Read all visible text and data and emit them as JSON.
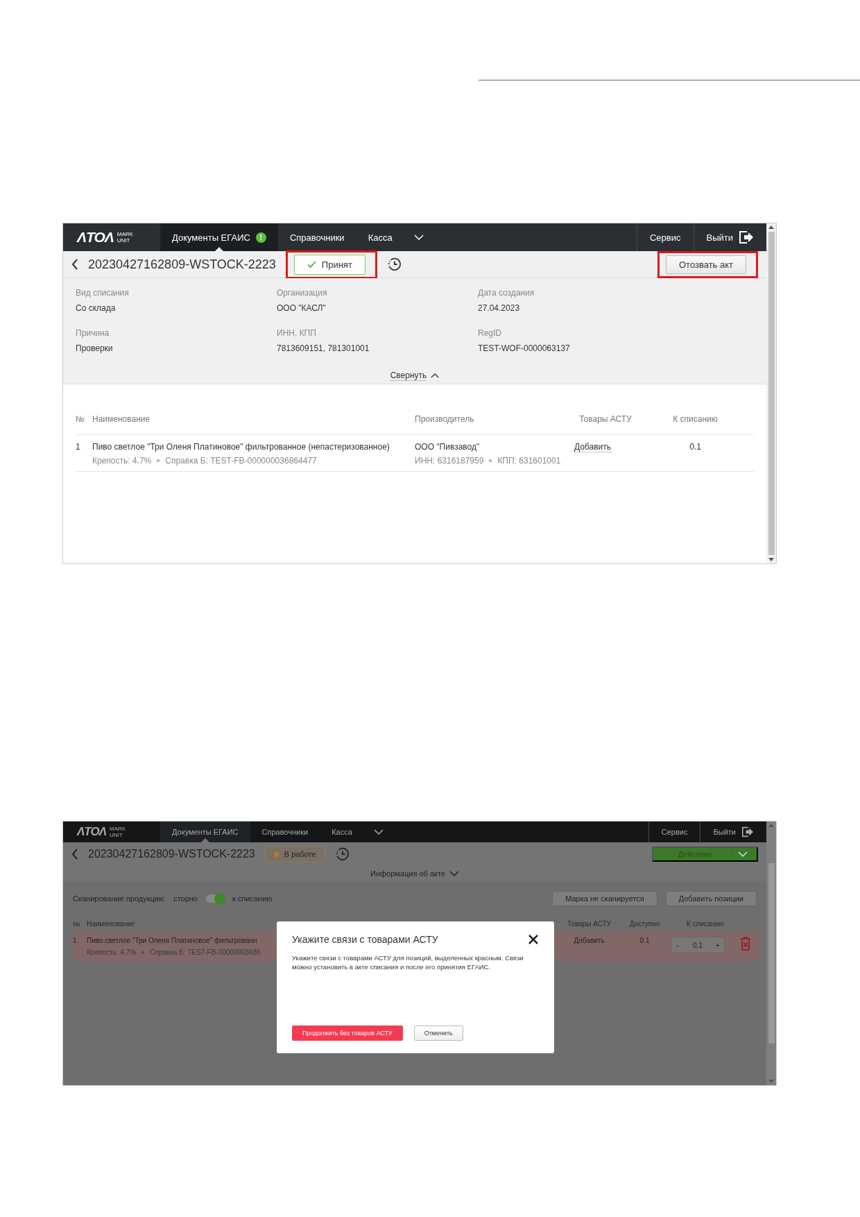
{
  "screen_accepted": {
    "nav": {
      "logo": "ΛTOΛ",
      "logo_tag_lines": [
        "MARK",
        "UNIT"
      ],
      "items": [
        {
          "label": "Документы ЕГАИС",
          "selected": true,
          "badge": "!"
        },
        {
          "label": "Справочники",
          "selected": false
        },
        {
          "label": "Касса",
          "selected": false
        }
      ],
      "right_items": [
        {
          "kind": "link",
          "label": "Сервис"
        },
        {
          "kind": "logout",
          "label": "Выйти"
        }
      ]
    },
    "document_number": "20230427162809-WSTOCK-2223",
    "status": {
      "kind": "accepted",
      "label": "Принят",
      "annotated": true
    },
    "action_button": {
      "label": "Отозвать акт",
      "annotated": true
    },
    "fields": [
      {
        "label": "Вид списания",
        "value": "Со склада"
      },
      {
        "label": "Организация",
        "value": "ООО \"КАСЛ\""
      },
      {
        "label": "Дата создания",
        "value": "27.04.2023"
      },
      {
        "label": "Причина",
        "value": "Проверки"
      },
      {
        "label": "ИНН, КПП",
        "value": "7813609151, 781301001"
      },
      {
        "label": "RegID",
        "value": "TEST-WOF-0000063137"
      }
    ],
    "collapse_link": "Свернуть",
    "table": {
      "columns": [
        "№",
        "Наименование",
        "Производитель",
        "Товары АСТУ",
        "К списанию"
      ],
      "rows": [
        {
          "number": "1",
          "name": "Пиво светлое \"Три Оленя Платиновое\" фильтрованное (непастеризованное)",
          "details": [
            "Крепость: 4.7%",
            "Справка Б: TEST-FB-000000036864477"
          ],
          "producer": "ООО \"Пивзавод\"",
          "producer_details": [
            "ИНН: 6316187959",
            "КПП: 631601001"
          ],
          "astu_link": "Добавить",
          "quantity": "0.1"
        }
      ]
    }
  },
  "screen_dialog": {
    "nav": {
      "logo": "ΛTOΛ",
      "logo_tag_lines": [
        "MARK",
        "UNIT"
      ],
      "items": [
        {
          "label": "Документы ЕГАИС",
          "selected": true
        },
        {
          "label": "Справочники",
          "selected": false
        },
        {
          "label": "Касса",
          "selected": false
        }
      ],
      "right_items": [
        {
          "kind": "link",
          "label": "Сервис"
        },
        {
          "kind": "logout",
          "label": "Выйти"
        }
      ]
    },
    "document_number": "20230427162809-WSTOCK-2223",
    "status": {
      "kind": "in_progress",
      "label": "В работе",
      "annotated": false
    },
    "actions_button": "Действия",
    "info_link": "Информация об акте",
    "scan": {
      "label": "Сканирование продукции:",
      "left": "сторно",
      "on": true,
      "right": "к списанию"
    },
    "toolbar_buttons": [
      "Марка не сканируется",
      "Добавить позиции"
    ],
    "table": {
      "columns": [
        "№",
        "Наименование",
        "Товары АСТУ",
        "Доступно",
        "К списанию"
      ],
      "rows": [
        {
          "number": "1",
          "name": "Пиво светлое \"Три Оленя Платиновое\" фильтрованн",
          "details": [
            "Крепость: 4.7%",
            "Справка Б: TEST-FB-00000003686"
          ],
          "astu_link": "Добавить",
          "available": "0.1",
          "minus": "-",
          "quantity": "0,1",
          "plus": "+",
          "highlighted": true
        }
      ]
    },
    "dialog": {
      "title": "Укажите связи с товарами АСТУ",
      "text": "Укажите связи с товарами АСТУ для позиций, выделенных красным. Связи можно установить в акте списания и после его принятия ЕГАИС.",
      "buttons": [
        {
          "kind": "primary",
          "label": "Продолжить без товаров АСТУ"
        },
        {
          "kind": "secondary",
          "label": "Отменить"
        }
      ]
    }
  }
}
